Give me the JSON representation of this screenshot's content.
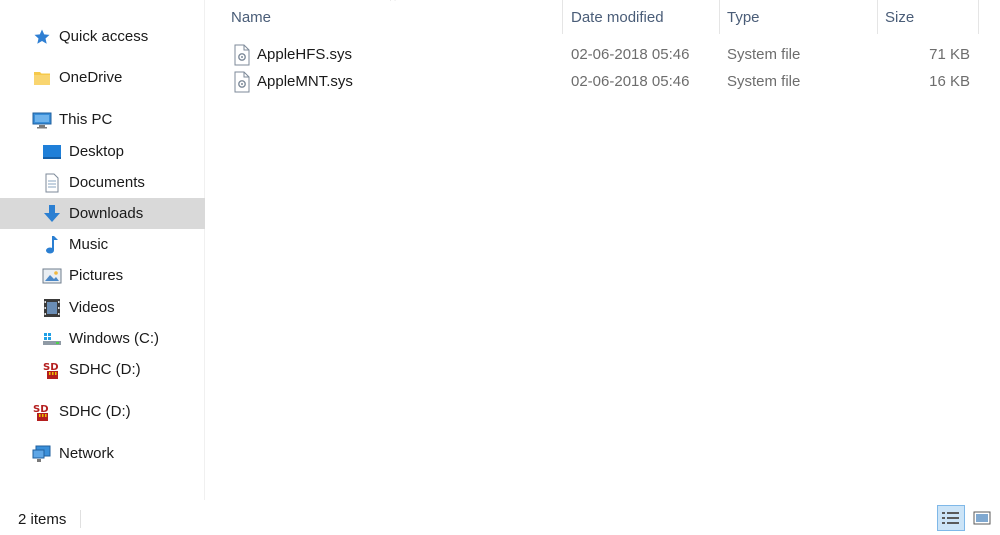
{
  "navigation": {
    "quick_access": "Quick access",
    "onedrive": "OneDrive",
    "this_pc": "This PC",
    "desktop": "Desktop",
    "documents": "Documents",
    "downloads": "Downloads",
    "music": "Music",
    "pictures": "Pictures",
    "videos": "Videos",
    "windows_c": "Windows (C:)",
    "sdhc_d_sub": "SDHC (D:)",
    "sdhc_d": "SDHC (D:)",
    "network": "Network",
    "selected": "Downloads"
  },
  "columns": {
    "name": "Name",
    "date_modified": "Date modified",
    "type": "Type",
    "size": "Size"
  },
  "files": [
    {
      "name": "AppleHFS.sys",
      "date": "02-06-2018 05:46",
      "type": "System file",
      "size": "71 KB"
    },
    {
      "name": "AppleMNT.sys",
      "date": "02-06-2018 05:46",
      "type": "System file",
      "size": "16 KB"
    }
  ],
  "status": {
    "item_count": "2 items"
  },
  "icons": {
    "sdhc_icon_text": "SD",
    "accent": "#0078d7",
    "folder_yellow": "#f6c94a",
    "sd_red": "#b41e1e"
  }
}
